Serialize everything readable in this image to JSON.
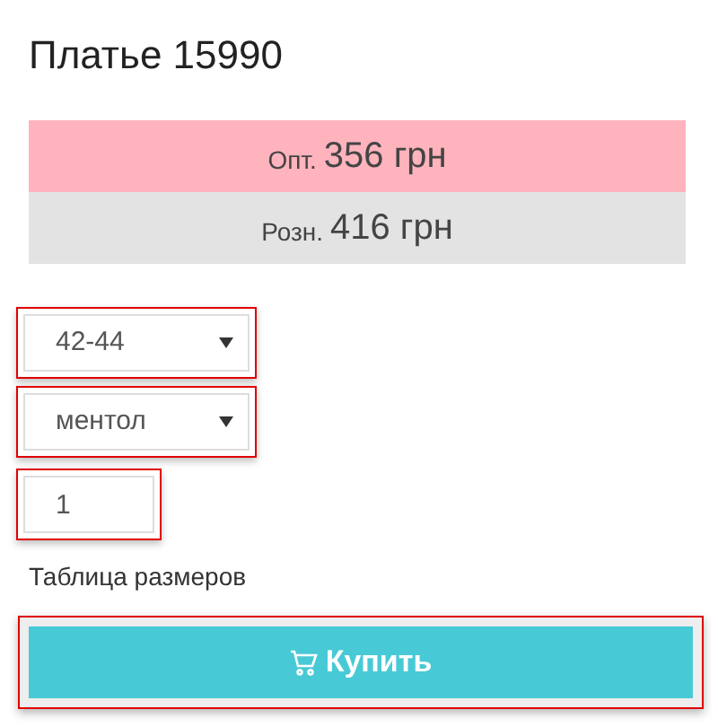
{
  "title": "Платье 15990",
  "prices": [
    {
      "kind": "wholesale",
      "label": "Опт.",
      "amount": "356 грн"
    },
    {
      "kind": "retail",
      "label": "Розн.",
      "amount": "416 грн"
    }
  ],
  "options": [
    {
      "value": "42-44"
    },
    {
      "value": "ментол"
    }
  ],
  "quantity": {
    "value": "1"
  },
  "size_chart_link": "Таблица размеров",
  "buy_button": {
    "label": "Купить"
  }
}
